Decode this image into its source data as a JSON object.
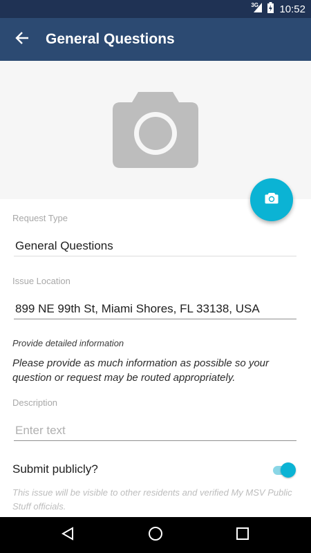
{
  "status_bar": {
    "network": "3G",
    "time": "10:52"
  },
  "app_bar": {
    "title": "General Questions",
    "back_icon": "arrow-back-icon"
  },
  "photo": {
    "placeholder_icon": "camera-icon",
    "fab_icon": "camera-icon"
  },
  "form": {
    "request_type_label": "Request Type",
    "request_type_value": "General Questions",
    "issue_location_label": "Issue Location",
    "issue_location_value": "899 NE 99th St, Miami Shores, FL 33138, USA",
    "detail_label": "Provide detailed information",
    "detail_text": "Please provide as much information as possible so your question or request may be routed appropriately.",
    "description_label": "Description",
    "description_placeholder": "Enter text",
    "submit_publicly_label": "Submit publicly?",
    "submit_publicly_on": true,
    "public_note": "This issue will be visible to other residents and verified My MSV Public Stuff officials."
  },
  "colors": {
    "status_bar": "#1f3254",
    "app_bar": "#2c4a72",
    "accent": "#0bb3d4"
  },
  "nav_bar": {
    "back": "nav-back-icon",
    "home": "nav-home-icon",
    "recents": "nav-recents-icon"
  }
}
